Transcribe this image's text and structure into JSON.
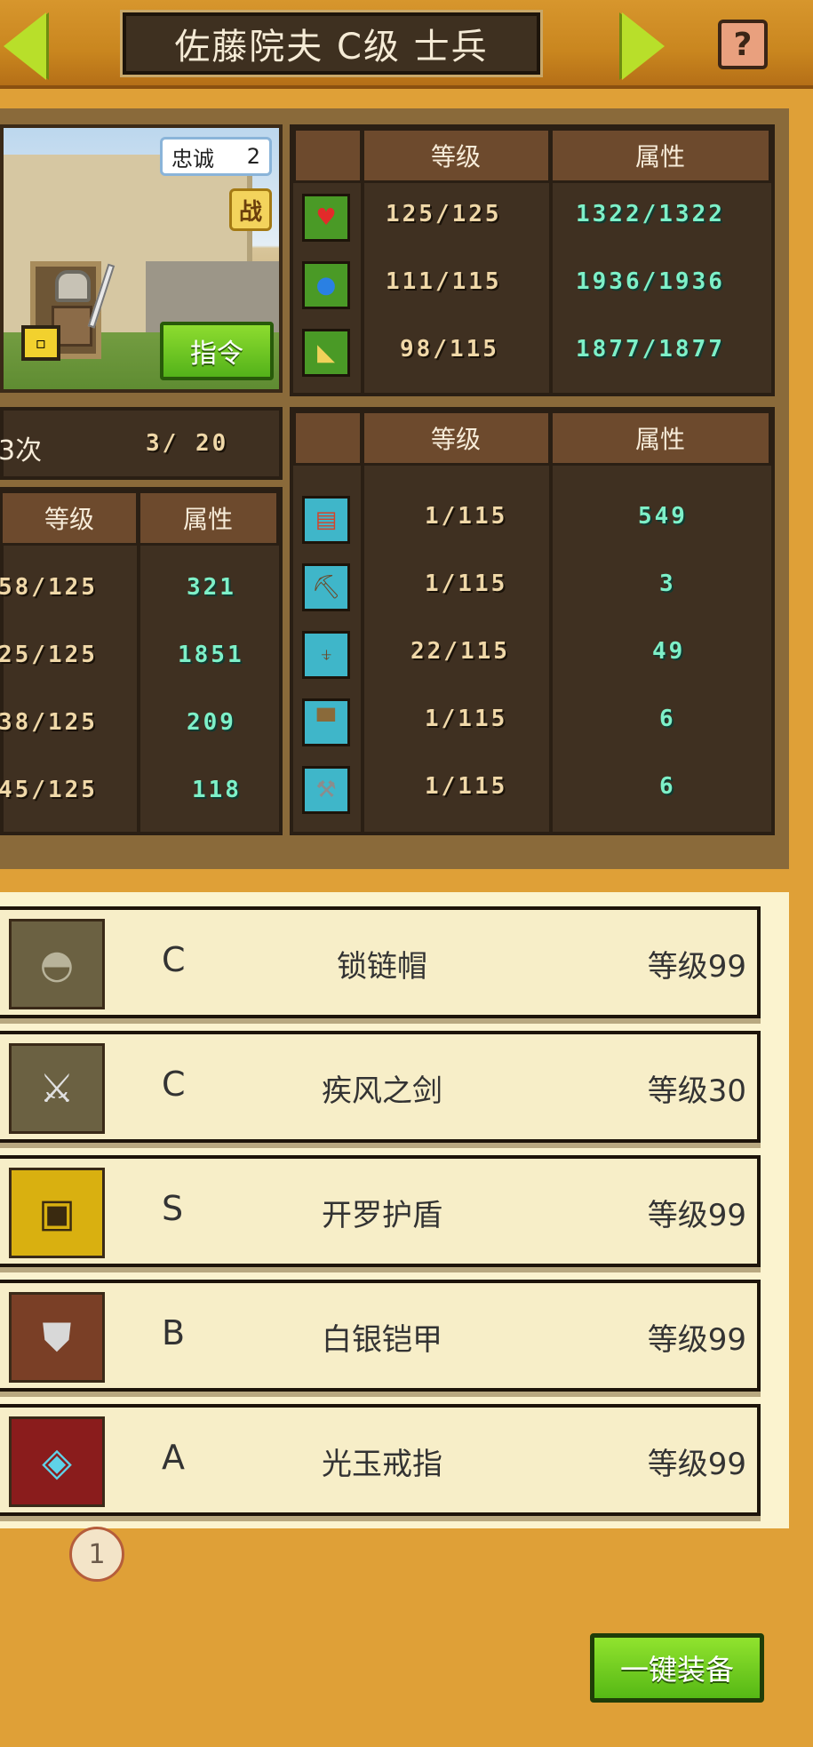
{
  "header": {
    "title": "佐藤院夫 C级 士兵",
    "help_label": "?"
  },
  "portrait": {
    "loyalty_label": "忠诚",
    "loyalty_value": "2",
    "battle_badge": "战",
    "command_button": "指令"
  },
  "times": {
    "label": "3次",
    "value": "3/ 20"
  },
  "main_stats": {
    "headers": [
      "等级",
      "属性"
    ],
    "rows": [
      {
        "icon": "heart-icon",
        "level": "125/125",
        "attr": "1322/1322"
      },
      {
        "icon": "potion-icon",
        "level": "111/115",
        "attr": "1936/1936"
      },
      {
        "icon": "muscle-icon",
        "level": "98/115",
        "attr": "1877/1877"
      }
    ]
  },
  "left_stats": {
    "headers": [
      "等级",
      "属性"
    ],
    "rows": [
      {
        "level": "58/125",
        "attr": "321"
      },
      {
        "level": "25/125",
        "attr": "1851"
      },
      {
        "level": "38/125",
        "attr": "209"
      },
      {
        "level": "45/125",
        "attr": "118"
      }
    ]
  },
  "skill_stats": {
    "headers": [
      "等级",
      "属性"
    ],
    "rows": [
      {
        "icon": "book-icon",
        "level": "1/115",
        "attr": "549"
      },
      {
        "icon": "pickaxe-icon",
        "level": "1/115",
        "attr": "3"
      },
      {
        "icon": "shovel-icon",
        "level": "22/115",
        "attr": "49"
      },
      {
        "icon": "anvil-icon",
        "level": "1/115",
        "attr": "6"
      },
      {
        "icon": "hammer-icon",
        "level": "1/115",
        "attr": "6"
      }
    ]
  },
  "equipment": [
    {
      "icon": "chain-helmet-icon",
      "rank": "C",
      "name": "锁链帽",
      "level": "等级99",
      "bg": "#6b6142"
    },
    {
      "icon": "sword-icon",
      "rank": "C",
      "name": "疾风之剑",
      "level": "等级30",
      "bg": "#6b6142"
    },
    {
      "icon": "cairo-shield-icon",
      "rank": "S",
      "name": "开罗护盾",
      "level": "等级99",
      "bg": "#d9b010"
    },
    {
      "icon": "silver-armor-icon",
      "rank": "B",
      "name": "白银铠甲",
      "level": "等级99",
      "bg": "#7a3f26"
    },
    {
      "icon": "jade-ring-icon",
      "rank": "A",
      "name": "光玉戒指",
      "level": "等级99",
      "bg": "#8a1c1c"
    }
  ],
  "page_badge": "1",
  "auto_equip_button": "一键装备",
  "colors": {
    "background": "#dfa037",
    "accent_green": "#8ddc2f",
    "level_text": "#f0d8a8",
    "attr_text": "#7ef0c8"
  }
}
